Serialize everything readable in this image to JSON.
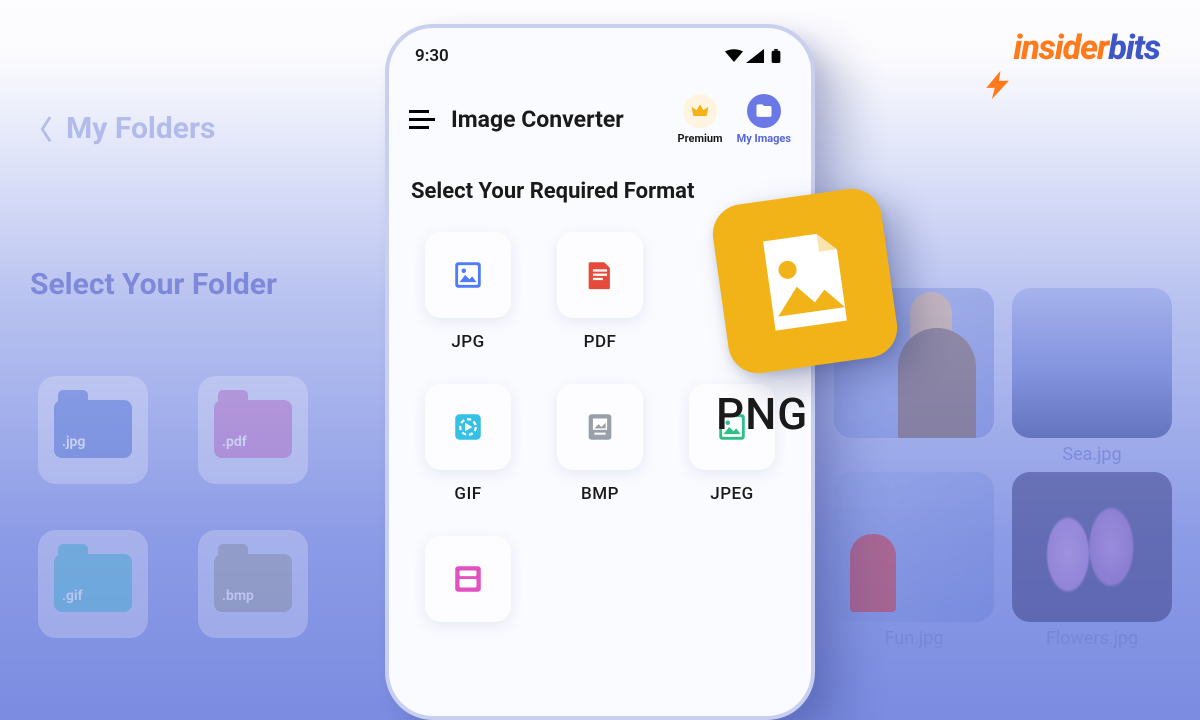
{
  "brand": {
    "name_a": "insider",
    "name_b": "bits"
  },
  "left_panel": {
    "back_label": "My Folders",
    "title": "Select Your Folder",
    "folders": [
      {
        "ext": ".jpg",
        "color": "fb-blue"
      },
      {
        "ext": ".pdf",
        "color": "fb-pink"
      },
      {
        "ext": "",
        "color": ""
      },
      {
        "ext": ".gif",
        "color": "fb-cyan"
      },
      {
        "ext": ".bmp",
        "color": "fb-gray"
      },
      {
        "ext": "",
        "color": ""
      }
    ]
  },
  "right_panel": {
    "images": [
      {
        "name": "",
        "kind": "portrait"
      },
      {
        "name": "Sea.jpg",
        "kind": "sea"
      },
      {
        "name": "Fun.jpg",
        "kind": "red"
      },
      {
        "name": "Flowers.jpg",
        "kind": "flowers"
      }
    ]
  },
  "phone": {
    "status_time": "9:30",
    "app_title": "Image Converter",
    "premium_label": "Premium",
    "myimages_label": "My Images",
    "section_title": "Select Your Required Format",
    "formats": [
      {
        "label": "JPG",
        "icon": "image-icon",
        "color": "#4f7cff"
      },
      {
        "label": "PDF",
        "icon": "doc-icon",
        "color": "#e64a3b"
      },
      {
        "label": "PNG",
        "icon": "png-icon",
        "color": "#f2b318"
      },
      {
        "label": "GIF",
        "icon": "play-icon",
        "color": "#35c0e6"
      },
      {
        "label": "BMP",
        "icon": "bmp-icon",
        "color": "#9aa0a9"
      },
      {
        "label": "JPEG",
        "icon": "image2-icon",
        "color": "#2fc08a"
      },
      {
        "label": "",
        "icon": "webp-icon",
        "color": "#e250c2"
      }
    ]
  },
  "callout": {
    "label": "PNG"
  }
}
